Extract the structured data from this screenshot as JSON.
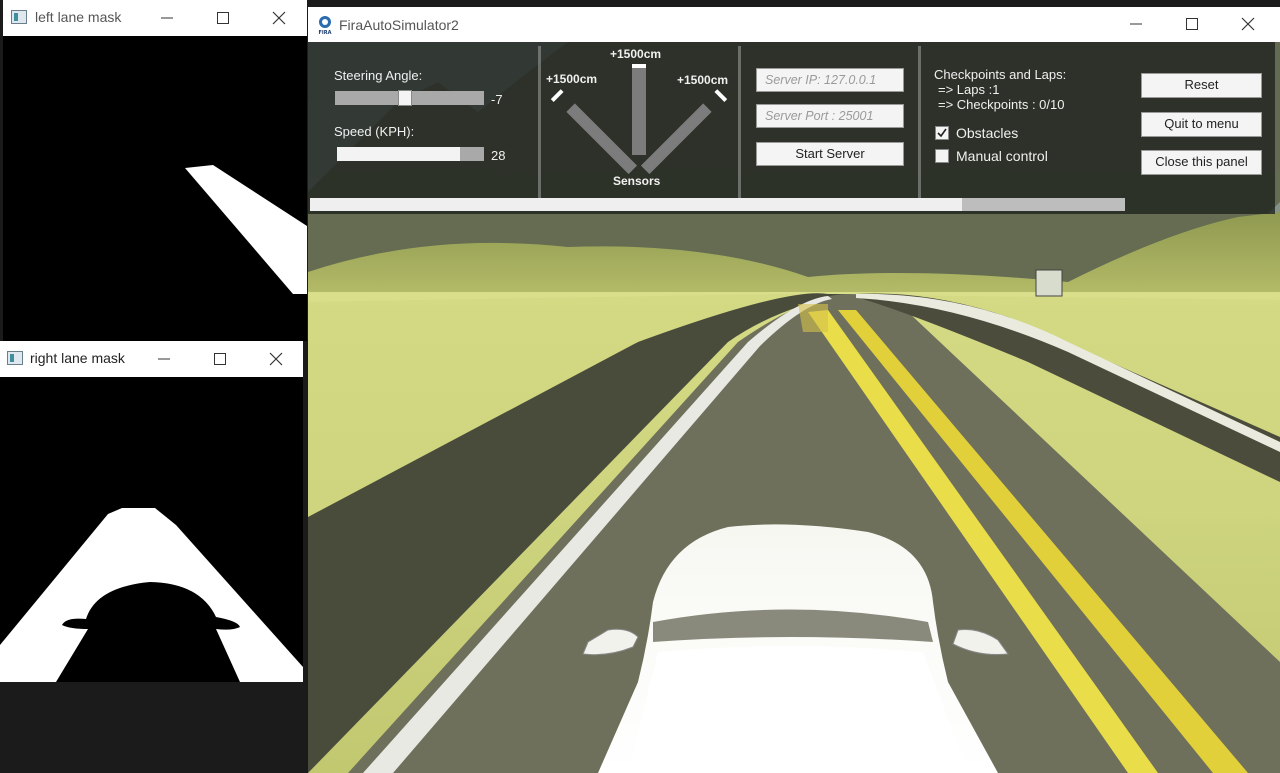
{
  "left_mask_window": {
    "title": "left lane mask"
  },
  "right_mask_window": {
    "title": "right lane mask"
  },
  "simulator": {
    "title": "FiraAutoSimulator2",
    "steering": {
      "label": "Steering Angle:",
      "value": "-7",
      "level": 0.47
    },
    "speed": {
      "label": "Speed (KPH):",
      "value": "28",
      "level": 0.84
    },
    "sensors": {
      "label": "Sensors",
      "left": "+1500cm",
      "center": "+1500cm",
      "right": "+1500cm"
    },
    "server_ip": {
      "placeholder": "Server IP: 127.0.0.1"
    },
    "server_port": {
      "placeholder": "Server Port : 25001"
    },
    "start_server_label": "Start Server",
    "checkpoints": {
      "heading": "Checkpoints and Laps:",
      "laps": "=> Laps :1",
      "checkpoints": "=> Checkpoints : 0/10"
    },
    "obstacles": {
      "label": "Obstacles",
      "checked": true
    },
    "manual_control": {
      "label": "Manual control",
      "checked": false
    },
    "buttons": {
      "reset": "Reset",
      "quit": "Quit to menu",
      "close_panel": "Close this panel"
    },
    "progress": 0.8
  }
}
